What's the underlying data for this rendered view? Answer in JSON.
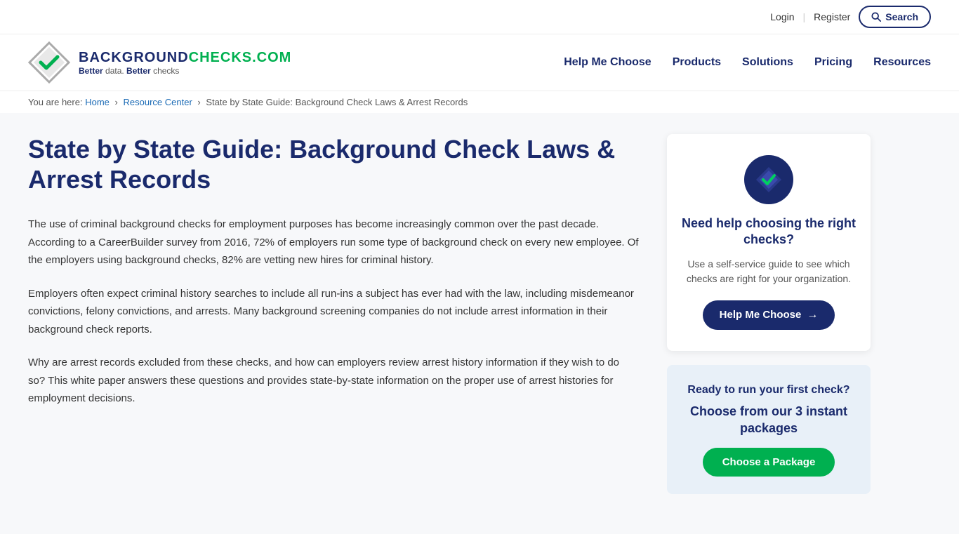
{
  "topbar": {
    "login_label": "Login",
    "register_label": "Register",
    "search_label": "Search"
  },
  "header": {
    "logo_bg": "BACKGROUND",
    "logo_checks": "CHECKS.COM",
    "logo_tagline_1": "Better",
    "logo_tagline_text_1": " data. ",
    "logo_tagline_2": "Better",
    "logo_tagline_text_2": " checks",
    "nav": [
      {
        "label": "Help Me Choose",
        "id": "help-me-choose"
      },
      {
        "label": "Products",
        "id": "products"
      },
      {
        "label": "Solutions",
        "id": "solutions"
      },
      {
        "label": "Pricing",
        "id": "pricing"
      },
      {
        "label": "Resources",
        "id": "resources"
      }
    ]
  },
  "breadcrumb": {
    "you_are_here": "You are here:",
    "home": "Home",
    "resource_center": "Resource Center",
    "current": "State by State Guide: Background Check Laws & Arrest Records"
  },
  "article": {
    "title": "State by State Guide: Background Check Laws & Arrest Records",
    "paragraphs": [
      "The use of criminal background checks for employment purposes has become increasingly common over the past decade. According to a CareerBuilder survey from 2016, 72% of employers run some type of background check on every new employee. Of the employers using background checks, 82% are vetting new hires for criminal history.",
      "Employers often expect criminal history searches to include all run-ins a subject has ever had with the law, including misdemeanor convictions, felony convictions, and arrests. Many background screening companies do not include arrest information in their background check reports.",
      "Why are arrest records excluded from these checks, and how can employers review arrest history information if they wish to do so? This white paper answers these questions and provides state-by-state information on the proper use of arrest histories for employment decisions."
    ]
  },
  "sidebar": {
    "card1": {
      "title": "Need help choosing the right checks?",
      "desc": "Use a self-service guide to see which checks are right for your organization.",
      "button_label": "Help Me Choose"
    },
    "card2": {
      "title": "Ready to run your first check?",
      "subtitle": "Choose from our 3 instant packages",
      "button_label": "Choose a Package"
    }
  }
}
